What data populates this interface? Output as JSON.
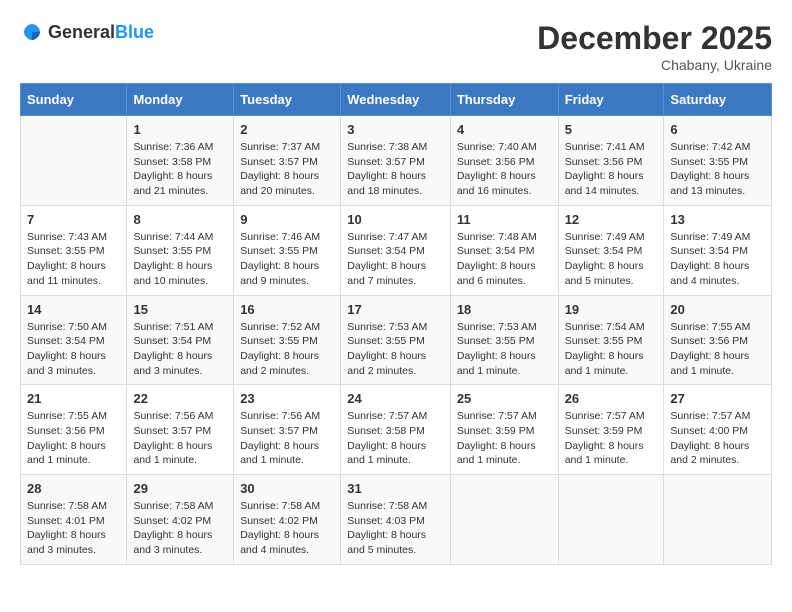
{
  "header": {
    "logo_general": "General",
    "logo_blue": "Blue",
    "month_title": "December 2025",
    "location": "Chabany, Ukraine"
  },
  "calendar": {
    "days_of_week": [
      "Sunday",
      "Monday",
      "Tuesday",
      "Wednesday",
      "Thursday",
      "Friday",
      "Saturday"
    ],
    "weeks": [
      [
        {
          "day": "",
          "info": ""
        },
        {
          "day": "1",
          "info": "Sunrise: 7:36 AM\nSunset: 3:58 PM\nDaylight: 8 hours\nand 21 minutes."
        },
        {
          "day": "2",
          "info": "Sunrise: 7:37 AM\nSunset: 3:57 PM\nDaylight: 8 hours\nand 20 minutes."
        },
        {
          "day": "3",
          "info": "Sunrise: 7:38 AM\nSunset: 3:57 PM\nDaylight: 8 hours\nand 18 minutes."
        },
        {
          "day": "4",
          "info": "Sunrise: 7:40 AM\nSunset: 3:56 PM\nDaylight: 8 hours\nand 16 minutes."
        },
        {
          "day": "5",
          "info": "Sunrise: 7:41 AM\nSunset: 3:56 PM\nDaylight: 8 hours\nand 14 minutes."
        },
        {
          "day": "6",
          "info": "Sunrise: 7:42 AM\nSunset: 3:55 PM\nDaylight: 8 hours\nand 13 minutes."
        }
      ],
      [
        {
          "day": "7",
          "info": "Sunrise: 7:43 AM\nSunset: 3:55 PM\nDaylight: 8 hours\nand 11 minutes."
        },
        {
          "day": "8",
          "info": "Sunrise: 7:44 AM\nSunset: 3:55 PM\nDaylight: 8 hours\nand 10 minutes."
        },
        {
          "day": "9",
          "info": "Sunrise: 7:46 AM\nSunset: 3:55 PM\nDaylight: 8 hours\nand 9 minutes."
        },
        {
          "day": "10",
          "info": "Sunrise: 7:47 AM\nSunset: 3:54 PM\nDaylight: 8 hours\nand 7 minutes."
        },
        {
          "day": "11",
          "info": "Sunrise: 7:48 AM\nSunset: 3:54 PM\nDaylight: 8 hours\nand 6 minutes."
        },
        {
          "day": "12",
          "info": "Sunrise: 7:49 AM\nSunset: 3:54 PM\nDaylight: 8 hours\nand 5 minutes."
        },
        {
          "day": "13",
          "info": "Sunrise: 7:49 AM\nSunset: 3:54 PM\nDaylight: 8 hours\nand 4 minutes."
        }
      ],
      [
        {
          "day": "14",
          "info": "Sunrise: 7:50 AM\nSunset: 3:54 PM\nDaylight: 8 hours\nand 3 minutes."
        },
        {
          "day": "15",
          "info": "Sunrise: 7:51 AM\nSunset: 3:54 PM\nDaylight: 8 hours\nand 3 minutes."
        },
        {
          "day": "16",
          "info": "Sunrise: 7:52 AM\nSunset: 3:55 PM\nDaylight: 8 hours\nand 2 minutes."
        },
        {
          "day": "17",
          "info": "Sunrise: 7:53 AM\nSunset: 3:55 PM\nDaylight: 8 hours\nand 2 minutes."
        },
        {
          "day": "18",
          "info": "Sunrise: 7:53 AM\nSunset: 3:55 PM\nDaylight: 8 hours\nand 1 minute."
        },
        {
          "day": "19",
          "info": "Sunrise: 7:54 AM\nSunset: 3:55 PM\nDaylight: 8 hours\nand 1 minute."
        },
        {
          "day": "20",
          "info": "Sunrise: 7:55 AM\nSunset: 3:56 PM\nDaylight: 8 hours\nand 1 minute."
        }
      ],
      [
        {
          "day": "21",
          "info": "Sunrise: 7:55 AM\nSunset: 3:56 PM\nDaylight: 8 hours\nand 1 minute."
        },
        {
          "day": "22",
          "info": "Sunrise: 7:56 AM\nSunset: 3:57 PM\nDaylight: 8 hours\nand 1 minute."
        },
        {
          "day": "23",
          "info": "Sunrise: 7:56 AM\nSunset: 3:57 PM\nDaylight: 8 hours\nand 1 minute."
        },
        {
          "day": "24",
          "info": "Sunrise: 7:57 AM\nSunset: 3:58 PM\nDaylight: 8 hours\nand 1 minute."
        },
        {
          "day": "25",
          "info": "Sunrise: 7:57 AM\nSunset: 3:59 PM\nDaylight: 8 hours\nand 1 minute."
        },
        {
          "day": "26",
          "info": "Sunrise: 7:57 AM\nSunset: 3:59 PM\nDaylight: 8 hours\nand 1 minute."
        },
        {
          "day": "27",
          "info": "Sunrise: 7:57 AM\nSunset: 4:00 PM\nDaylight: 8 hours\nand 2 minutes."
        }
      ],
      [
        {
          "day": "28",
          "info": "Sunrise: 7:58 AM\nSunset: 4:01 PM\nDaylight: 8 hours\nand 3 minutes."
        },
        {
          "day": "29",
          "info": "Sunrise: 7:58 AM\nSunset: 4:02 PM\nDaylight: 8 hours\nand 3 minutes."
        },
        {
          "day": "30",
          "info": "Sunrise: 7:58 AM\nSunset: 4:02 PM\nDaylight: 8 hours\nand 4 minutes."
        },
        {
          "day": "31",
          "info": "Sunrise: 7:58 AM\nSunset: 4:03 PM\nDaylight: 8 hours\nand 5 minutes."
        },
        {
          "day": "",
          "info": ""
        },
        {
          "day": "",
          "info": ""
        },
        {
          "day": "",
          "info": ""
        }
      ]
    ]
  }
}
